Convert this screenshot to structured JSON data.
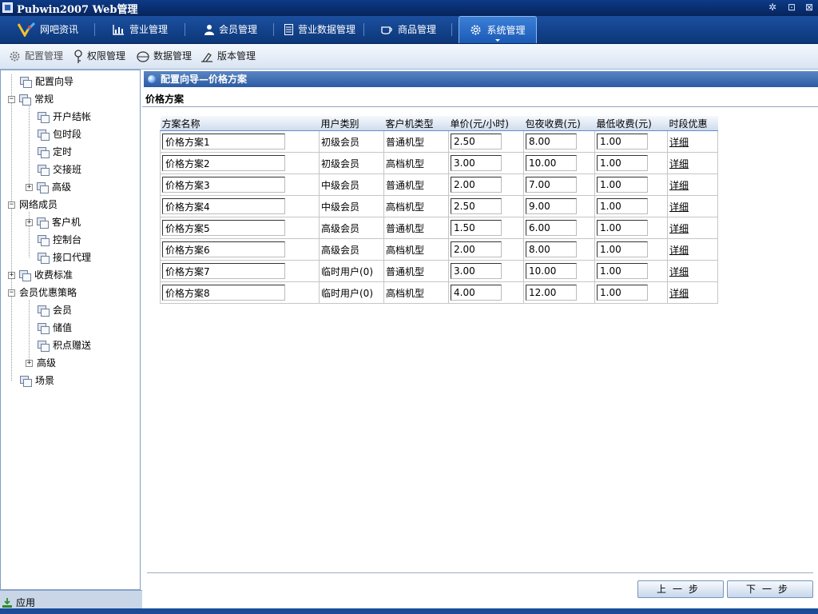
{
  "window": {
    "title": "Pubwin2007 Web管理"
  },
  "main_nav": [
    {
      "label": "网吧资讯",
      "icon": "pubwin-logo-icon"
    },
    {
      "label": "营业管理",
      "icon": "bar-chart-icon"
    },
    {
      "label": "会员管理",
      "icon": "user-icon"
    },
    {
      "label": "营业数据管理",
      "icon": "document-icon"
    },
    {
      "label": "商品管理",
      "icon": "cup-icon"
    },
    {
      "label": "系统管理",
      "icon": "gear-icon",
      "active": true
    }
  ],
  "sub_nav": [
    {
      "label": "配置管理",
      "icon": "gear-icon"
    },
    {
      "label": "权限管理",
      "icon": "key-icon"
    },
    {
      "label": "数据管理",
      "icon": "database-icon"
    },
    {
      "label": "版本管理",
      "icon": "version-icon"
    }
  ],
  "tree": {
    "items": [
      {
        "label": "配置向导"
      },
      {
        "label": "常规",
        "toggle": "−"
      },
      {
        "label": "开户结帐"
      },
      {
        "label": "包时段"
      },
      {
        "label": "定时"
      },
      {
        "label": "交接班"
      },
      {
        "label": "高级",
        "toggle": "+"
      },
      {
        "label": "网络成员",
        "toggle": "−"
      },
      {
        "label": "客户机",
        "toggle": "+"
      },
      {
        "label": "控制台"
      },
      {
        "label": "接口代理"
      },
      {
        "label": "收费标准",
        "toggle": "+"
      },
      {
        "label": "会员优惠策略",
        "toggle": "−"
      },
      {
        "label": "会员"
      },
      {
        "label": "储值"
      },
      {
        "label": "积点赠送"
      },
      {
        "label": "高级",
        "toggle": "+"
      },
      {
        "label": "场景"
      }
    ],
    "apply_label": "应用"
  },
  "content": {
    "panel_title": "配置向导—价格方案",
    "section_title": "价格方案",
    "table": {
      "headers": [
        "方案名称",
        "用户类别",
        "客户机类型",
        "单价(元/小时)",
        "包夜收费(元)",
        "最低收费(元)",
        "时段优惠"
      ],
      "rows": [
        {
          "name": "价格方案1",
          "user_type": "初级会员",
          "machine_type": "普通机型",
          "unit_price": "2.50",
          "night_fee": "8.00",
          "min_fee": "1.00",
          "discount": "详细"
        },
        {
          "name": "价格方案2",
          "user_type": "初级会员",
          "machine_type": "高档机型",
          "unit_price": "3.00",
          "night_fee": "10.00",
          "min_fee": "1.00",
          "discount": "详细"
        },
        {
          "name": "价格方案3",
          "user_type": "中级会员",
          "machine_type": "普通机型",
          "unit_price": "2.00",
          "night_fee": "7.00",
          "min_fee": "1.00",
          "discount": "详细"
        },
        {
          "name": "价格方案4",
          "user_type": "中级会员",
          "machine_type": "高档机型",
          "unit_price": "2.50",
          "night_fee": "9.00",
          "min_fee": "1.00",
          "discount": "详细"
        },
        {
          "name": "价格方案5",
          "user_type": "高级会员",
          "machine_type": "普通机型",
          "unit_price": "1.50",
          "night_fee": "6.00",
          "min_fee": "1.00",
          "discount": "详细"
        },
        {
          "name": "价格方案6",
          "user_type": "高级会员",
          "machine_type": "高档机型",
          "unit_price": "2.00",
          "night_fee": "8.00",
          "min_fee": "1.00",
          "discount": "详细"
        },
        {
          "name": "价格方案7",
          "user_type": "临时用户(0)",
          "machine_type": "普通机型",
          "unit_price": "3.00",
          "night_fee": "10.00",
          "min_fee": "1.00",
          "discount": "详细"
        },
        {
          "name": "价格方案8",
          "user_type": "临时用户(0)",
          "machine_type": "高档机型",
          "unit_price": "4.00",
          "night_fee": "12.00",
          "min_fee": "1.00",
          "discount": "详细"
        }
      ]
    },
    "prev_label": "上一步",
    "next_label": "下一步"
  },
  "colors": {
    "titlebar": "#0d3a86",
    "nav": "#1b4f9f",
    "nav_active": "#3c7fd6",
    "panel_header": "#2c5aa2",
    "sidebar_border": "#7f9dc8"
  }
}
